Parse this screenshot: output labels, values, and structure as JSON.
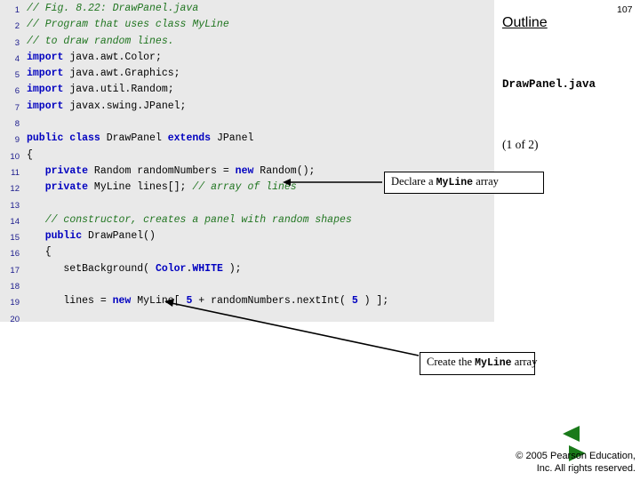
{
  "page_number": "107",
  "outline": {
    "title": "Outline",
    "file_name": "DrawPanel.java",
    "page_of": "(1 of 2)"
  },
  "code": {
    "lines": [
      {
        "n": "1",
        "segments": [
          {
            "t": "// Fig. 8.22: DrawPanel.java",
            "c": "cm"
          }
        ]
      },
      {
        "n": "2",
        "segments": [
          {
            "t": "// Program that uses class MyLine",
            "c": "cm"
          }
        ]
      },
      {
        "n": "3",
        "segments": [
          {
            "t": "// to draw random lines.",
            "c": "cm"
          }
        ]
      },
      {
        "n": "4",
        "segments": [
          {
            "t": "import",
            "c": "kw"
          },
          {
            "t": " java.awt.Color;",
            "c": "pl"
          }
        ]
      },
      {
        "n": "5",
        "segments": [
          {
            "t": "import",
            "c": "kw"
          },
          {
            "t": " java.awt.Graphics;",
            "c": "pl"
          }
        ]
      },
      {
        "n": "6",
        "segments": [
          {
            "t": "import",
            "c": "kw"
          },
          {
            "t": " java.util.Random;",
            "c": "pl"
          }
        ]
      },
      {
        "n": "7",
        "segments": [
          {
            "t": "import",
            "c": "kw"
          },
          {
            "t": " javax.swing.JPanel;",
            "c": "pl"
          }
        ]
      },
      {
        "n": "8",
        "segments": []
      },
      {
        "n": "9",
        "segments": [
          {
            "t": "public class",
            "c": "kw"
          },
          {
            "t": " DrawPanel ",
            "c": "pl"
          },
          {
            "t": "extends",
            "c": "kw"
          },
          {
            "t": " JPanel",
            "c": "pl"
          }
        ]
      },
      {
        "n": "10",
        "segments": [
          {
            "t": "{",
            "c": "pl"
          }
        ]
      },
      {
        "n": "11",
        "segments": [
          {
            "t": "   ",
            "c": "pl"
          },
          {
            "t": "private",
            "c": "kw"
          },
          {
            "t": " Random randomNumbers = ",
            "c": "pl"
          },
          {
            "t": "new",
            "c": "kw"
          },
          {
            "t": " Random();",
            "c": "pl"
          }
        ]
      },
      {
        "n": "12",
        "segments": [
          {
            "t": "   ",
            "c": "pl"
          },
          {
            "t": "private",
            "c": "kw"
          },
          {
            "t": " MyLine lines[]; ",
            "c": "pl"
          },
          {
            "t": "// array of lines",
            "c": "cm"
          }
        ]
      },
      {
        "n": "13",
        "segments": []
      },
      {
        "n": "14",
        "segments": [
          {
            "t": "   ",
            "c": "pl"
          },
          {
            "t": "// constructor, creates a panel with random shapes",
            "c": "cm"
          }
        ]
      },
      {
        "n": "15",
        "segments": [
          {
            "t": "   ",
            "c": "pl"
          },
          {
            "t": "public",
            "c": "kw"
          },
          {
            "t": " DrawPanel()",
            "c": "pl"
          }
        ]
      },
      {
        "n": "16",
        "segments": [
          {
            "t": "   {",
            "c": "pl"
          }
        ]
      },
      {
        "n": "17",
        "segments": [
          {
            "t": "      setBackground( ",
            "c": "pl"
          },
          {
            "t": "Color",
            "c": "kw"
          },
          {
            "t": ".",
            "c": "pl"
          },
          {
            "t": "WHITE",
            "c": "kw"
          },
          {
            "t": " );",
            "c": "pl"
          }
        ]
      },
      {
        "n": "18",
        "segments": []
      },
      {
        "n": "19",
        "segments": [
          {
            "t": "      lines = ",
            "c": "pl"
          },
          {
            "t": "new",
            "c": "kw"
          },
          {
            "t": " MyLine[ ",
            "c": "pl"
          },
          {
            "t": "5",
            "c": "kw"
          },
          {
            "t": " + randomNumbers.nextInt( ",
            "c": "pl"
          },
          {
            "t": "5",
            "c": "kw"
          },
          {
            "t": " ) ];",
            "c": "pl"
          }
        ]
      },
      {
        "n": "20",
        "segments": []
      }
    ]
  },
  "callouts": [
    {
      "prefix": "Declare a ",
      "mono": "MyLine",
      "suffix": " array"
    },
    {
      "prefix": "Create the ",
      "mono": "MyLine",
      "suffix": " array"
    }
  ],
  "nav": {
    "previous_label": "previous-slide",
    "next_label": "next-slide"
  },
  "footer": {
    "line1": "© 2005 Pearson Education,",
    "line2": "Inc.  All rights reserved."
  },
  "colors": {
    "code_background": "#e9e9e9",
    "comment": "#207520",
    "keyword": "#0000c0",
    "line_number": "#1a1a8c",
    "nav_button": "#1a7a1a"
  }
}
